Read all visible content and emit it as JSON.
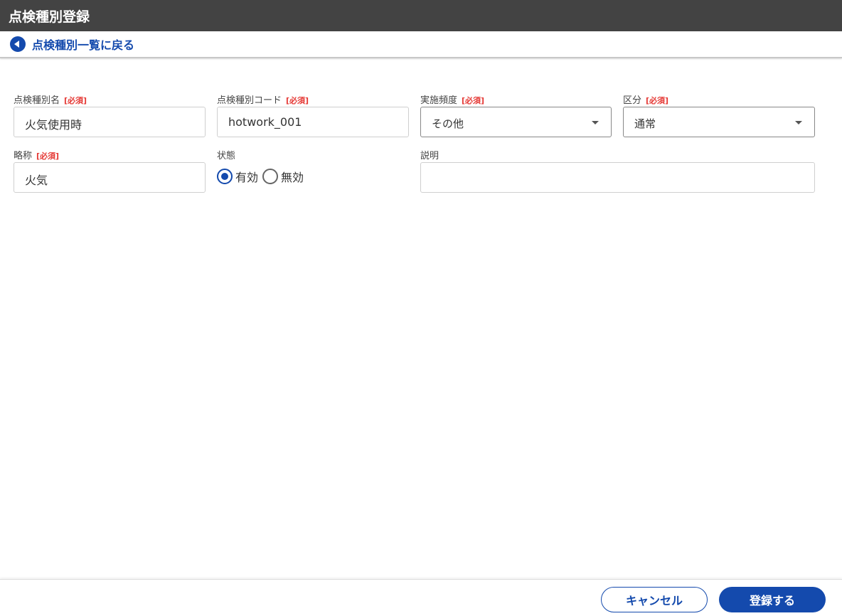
{
  "header": {
    "title": "点検種別登録"
  },
  "back": {
    "label": "点検種別一覧に戻る"
  },
  "required": "[必須]",
  "fields": {
    "name": {
      "label": "点検種別名",
      "value": "火気使用時"
    },
    "code": {
      "label": "点検種別コード",
      "value": "hotwork_001"
    },
    "frequency": {
      "label": "実施頻度",
      "value": "その他"
    },
    "category": {
      "label": "区分",
      "value": "通常"
    },
    "short": {
      "label": "略称",
      "value": "火気"
    },
    "status": {
      "label": "状態",
      "options": [
        "有効",
        "無効"
      ],
      "selected": "有効"
    },
    "description": {
      "label": "説明",
      "value": ""
    }
  },
  "footer": {
    "cancel": "キャンセル",
    "submit": "登録する"
  }
}
